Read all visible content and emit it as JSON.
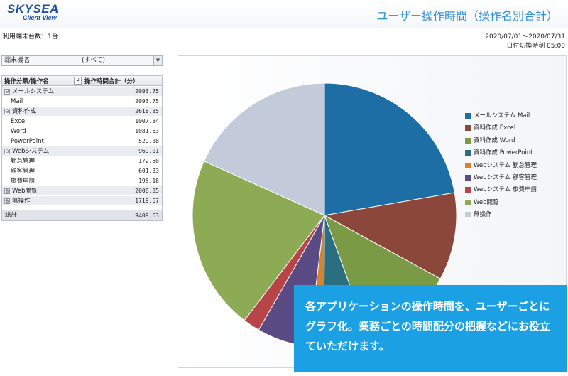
{
  "header": {
    "logo_line1": "SKYSEA",
    "logo_line2": "Client View",
    "title": "ユーザー操作時間（操作名別合計）"
  },
  "info": {
    "terminal_count": "利用端末台数：1台",
    "date_range": "2020/07/01～2020/07/31",
    "switch_time": "日付切換時刻 05:00"
  },
  "filter": {
    "label": "端末機名",
    "value": "(すべて)"
  },
  "table": {
    "col_category": "操作分類/操作名",
    "col_time": "操作時間合計（分）",
    "rows": [
      {
        "label": "メールシステム",
        "value": "2093.75",
        "group": true,
        "toggle": "⊖"
      },
      {
        "label": "Mail",
        "value": "2093.75",
        "group": false
      },
      {
        "label": "資料作成",
        "value": "2618.85",
        "group": true,
        "toggle": "⊖"
      },
      {
        "label": "Excel",
        "value": "1007.84",
        "group": false
      },
      {
        "label": "Word",
        "value": "1081.63",
        "group": false
      },
      {
        "label": "PowerPoint",
        "value": "529.38",
        "group": false
      },
      {
        "label": "Webシステム",
        "value": "969.01",
        "group": true,
        "toggle": "⊖"
      },
      {
        "label": "勤怠管理",
        "value": "172.50",
        "group": false
      },
      {
        "label": "顧客管理",
        "value": "601.33",
        "group": false
      },
      {
        "label": "旅費申請",
        "value": "195.18",
        "group": false
      },
      {
        "label": "Web閲覧",
        "value": "2008.35",
        "group": true,
        "toggle": "⊕"
      },
      {
        "label": "無操作",
        "value": "1719.67",
        "group": true,
        "toggle": "⊕"
      }
    ],
    "total_label": "総計",
    "total_value": "9409.63"
  },
  "chart_data": {
    "type": "pie",
    "start_angle_deg": 0,
    "direction": "clockwise",
    "slices": [
      {
        "name": "メールシステム Mail",
        "value": 2093.75,
        "color": "#1c6ea4"
      },
      {
        "name": "資料作成 Excel",
        "value": 1007.84,
        "color": "#8b473a"
      },
      {
        "name": "資料作成 Word",
        "value": 1081.63,
        "color": "#7a9a46"
      },
      {
        "name": "資料作成 PowerPoint",
        "value": 529.38,
        "color": "#2b6e7f"
      },
      {
        "name": "Webシステム 勤怠管理",
        "value": 172.5,
        "color": "#d5842e"
      },
      {
        "name": "Webシステム 顧客管理",
        "value": 601.33,
        "color": "#5b4b85"
      },
      {
        "name": "Webシステム 旅費申請",
        "value": 195.18,
        "color": "#b94447"
      },
      {
        "name": "Web閲覧",
        "value": 2008.35,
        "color": "#8daa54"
      },
      {
        "name": "無操作",
        "value": 1719.67,
        "color": "#c3cad9"
      }
    ],
    "legend_position": "right"
  },
  "caption": {
    "text": "各アプリケーションの操作時間を、ユーザーごとにグラフ化。業務ごとの時間配分の把握などにお役立ていただけます。"
  }
}
